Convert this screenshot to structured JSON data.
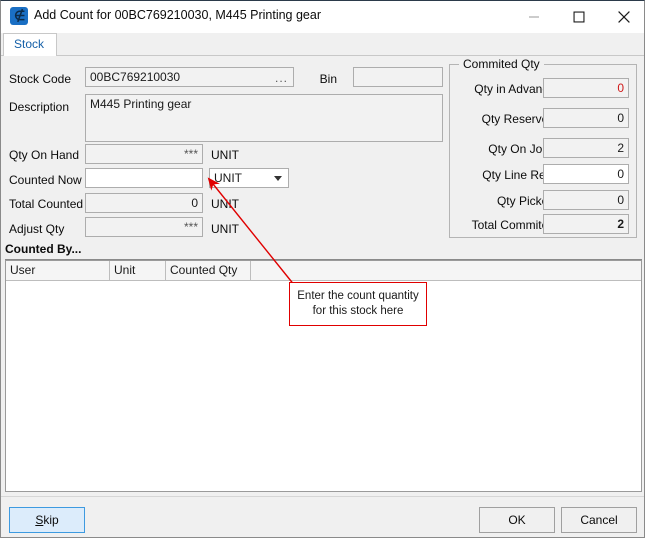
{
  "window": {
    "title": "Add Count for 00BC769210030, M445 Printing gear",
    "icon": "stock-app-icon",
    "minimize_label": "minimize-icon",
    "maximize_label": "maximize-icon",
    "close_label": "close-icon"
  },
  "tabs": [
    {
      "label": "Stock",
      "active": true
    }
  ],
  "form": {
    "stock_code": {
      "label": "Stock Code",
      "value": "00BC769210030",
      "browse": "..."
    },
    "bin": {
      "label": "Bin",
      "value": "",
      "placeholder": ""
    },
    "description": {
      "label": "Description",
      "value": "M445 Printing gear"
    },
    "qty_on_hand": {
      "label": "Qty On Hand",
      "value": "***",
      "unit": "UNIT"
    },
    "counted_now": {
      "label": "Counted Now",
      "value": "",
      "unit": "UNIT",
      "unit_options": [
        "UNIT"
      ]
    },
    "total_counted": {
      "label": "Total Counted",
      "value": "0",
      "unit": "UNIT"
    },
    "adjust_qty": {
      "label": "Adjust Qty",
      "value": "***",
      "unit": "UNIT"
    }
  },
  "committed": {
    "legend": "Commited Qty",
    "rows": [
      {
        "label": "Qty in Advance",
        "value": "0",
        "color": "#d01a1a",
        "editable": false,
        "bold": false
      },
      {
        "label": "Qty Reserved",
        "value": "0",
        "color": "#1a1a1a",
        "editable": false,
        "bold": false
      },
      {
        "label": "Qty On Jobs",
        "value": "2",
        "color": "#1a1a1a",
        "editable": false,
        "bold": false
      },
      {
        "label": "Qty Line Res.",
        "value": "0",
        "color": "#1a1a1a",
        "editable": true,
        "bold": false
      },
      {
        "label": "Qty Picked",
        "value": "0",
        "color": "#1a1a1a",
        "editable": false,
        "bold": false
      },
      {
        "label": "Total Commited",
        "value": "2",
        "color": "#000000",
        "editable": false,
        "bold": true
      }
    ]
  },
  "counted_by": {
    "title": "Counted By...",
    "columns": [
      "User",
      "Unit",
      "Counted Qty"
    ],
    "rows": []
  },
  "annotation": {
    "line1": "Enter the count quantity",
    "line2": "for this stock here",
    "border_color": "#e00000"
  },
  "footer": {
    "skip": "Skip",
    "skip_accel": "S",
    "ok": "OK",
    "cancel": "Cancel"
  }
}
